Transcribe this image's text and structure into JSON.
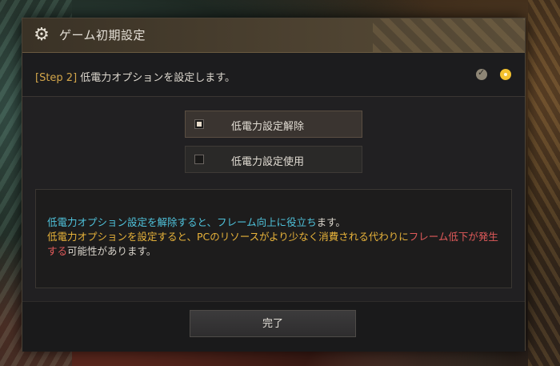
{
  "dialog": {
    "title": "ゲーム初期設定",
    "icon": "gear-icon"
  },
  "step": {
    "tag": "[Step 2]",
    "text": " 低電力オプションを設定します。",
    "indicators": [
      {
        "name": "step-1",
        "state": "completed"
      },
      {
        "name": "step-2",
        "state": "current"
      }
    ]
  },
  "options": [
    {
      "label": "低電力設定解除",
      "selected": true
    },
    {
      "label": "低電力設定使用",
      "selected": false
    }
  ],
  "info": {
    "line1": [
      {
        "text": "低電力オプション設定を解除すると、",
        "color": "#4fc3dc"
      },
      {
        "text": "フレーム向上に役立ち",
        "color": "#4fc3dc"
      },
      {
        "text": "ます。",
        "color": "#d8d3ca"
      }
    ],
    "line2": [
      {
        "text": "低電力オプションを設定すると、PCのリソースがより少なく消費される代わりに",
        "color": "#e8b33a"
      },
      {
        "text": "フレーム低下が発生する",
        "color": "#e05a5a"
      },
      {
        "text": "可能性があります。",
        "color": "#d8d3ca"
      }
    ]
  },
  "footer": {
    "done_label": "完了"
  },
  "colors": {
    "accent_gold": "#d2a54a",
    "highlight_cyan": "#4fc3dc",
    "warning_yellow": "#e8b33a",
    "warning_red": "#e05a5a"
  }
}
